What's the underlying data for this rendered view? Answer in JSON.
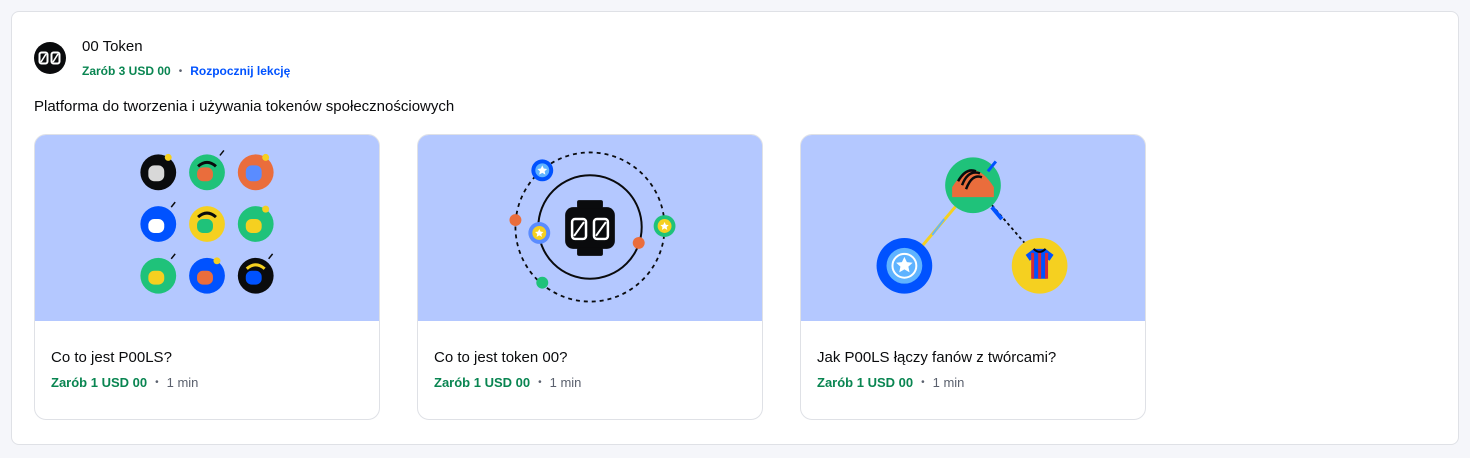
{
  "asset": {
    "name": "00 Token",
    "logo_text": "00",
    "earn": "Zarób 3 USD 00",
    "start_link": "Rozpocznij lekcję",
    "description": "Platforma do tworzenia i używania tokenów społecznościowych"
  },
  "lessons": [
    {
      "title": "Co to jest P00LS?",
      "earn": "Zarób 1 USD 00",
      "duration": "1 min"
    },
    {
      "title": "Co to jest token 00?",
      "earn": "Zarób 1 USD 00",
      "duration": "1 min"
    },
    {
      "title": "Jak P00LS łączy fanów z twórcami?",
      "earn": "Zarób 1 USD 00",
      "duration": "1 min"
    }
  ],
  "separator": "•",
  "colors": {
    "earn_green": "#098551",
    "link_blue": "#0052ff",
    "art_background": "#b4c8ff"
  }
}
